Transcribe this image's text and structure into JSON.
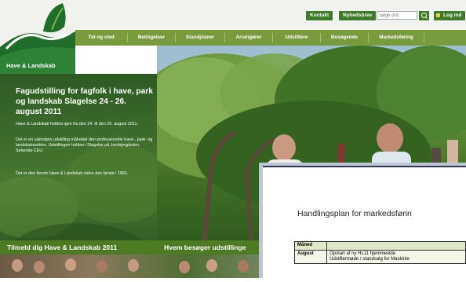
{
  "top": {
    "contact_label": "Kontakt",
    "newsletter_label": "Nyhedsbrev",
    "search_placeholder": "Søge ord",
    "login_label": "Log ind"
  },
  "logo": {
    "name": "Have & Landskab"
  },
  "nav": {
    "items": [
      "Tid og sted",
      "Betingelser",
      "Standplaner",
      "Arrangører",
      "Udstillere",
      "Besøgende",
      "Markedsføring"
    ]
  },
  "hero": {
    "title": "Fagudstilling for fagfolk i have, park og landskab Slagelse 24 - 26. august 2011",
    "p1": "Have & Landskab holdes igen fra den 24. til den 26. august 2011.",
    "p2": "Det er en udendørs udstilling målrettet den professionelle have-, park- og landskabssektor. Udstillingen holdes i Slagelse på Jernbjergården, Selandia-CEU.",
    "p3": "Det er den tiende Have & Landskab siden den første i 1992."
  },
  "bottom": {
    "signup_label": "Tilmeld dig Have & Landskab 2011",
    "visitors_label": "Hvem besøger udstillinge"
  },
  "document": {
    "title": "Handlingsplan for markedsførin",
    "table": {
      "header_month": "Måned",
      "rows": [
        {
          "month": "August",
          "line1": "Opstart af ny HL11 hjemmeside",
          "line2": "Udstillermøde / standsalg  for Maskinle"
        }
      ]
    }
  },
  "colors": {
    "brand_green": "#3f7a2a",
    "nav_green": "#7a9b3d",
    "logo_green": "#1f6e2a",
    "bar_green": "#4e7a24"
  }
}
